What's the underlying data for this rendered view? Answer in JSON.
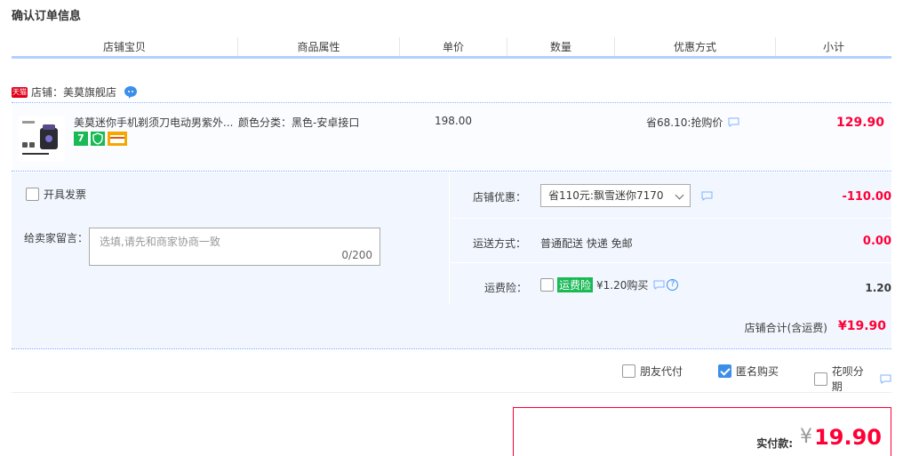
{
  "page": {
    "title": "确认订单信息"
  },
  "columns": [
    "店铺宝贝",
    "商品属性",
    "单价",
    "数量",
    "优惠方式",
    "小计"
  ],
  "shop": {
    "badge": "天猫",
    "label": "店铺：美莫旗舰店"
  },
  "item": {
    "title": "美莫迷你手机剃须刀电动男紫外...",
    "attribute": "颜色分类：黑色-安卓接口",
    "unit_price": "198.00",
    "discount": "省68.10:抢购价",
    "subtotal": "129.90",
    "badge_seven": "7"
  },
  "options": {
    "invoice_label": "开具发票",
    "message_label": "给卖家留言：",
    "message_placeholder": "选填,请先和商家协商一致",
    "message_count": "0/200",
    "shop_discount_label": "店铺优惠：",
    "shop_discount_selected": "省110元:飘雪迷你7170",
    "shop_discount_value": "-110.00",
    "shipping_label": "运送方式：",
    "shipping_text": "普通配送 快递 免邮",
    "shipping_value": "0.00",
    "insurance_label": "运费险：",
    "insurance_tag": "运费险",
    "insurance_text": "¥1.20购买",
    "insurance_value": "1.20"
  },
  "shop_total": {
    "label": "店铺合计(含运费)",
    "value": "¥19.90"
  },
  "pay_options": {
    "friend_pay": "朋友代付",
    "anonymous": "匿名购买",
    "anonymous_checked": true,
    "huabei": "花呗分期"
  },
  "final": {
    "label": "实付款:",
    "currency": "¥",
    "amount": "19.90"
  },
  "colors": {
    "accent_red": "#ff0036",
    "accent_blue": "#3c8fe8",
    "panel_bg": "#f2f7ff",
    "green": "#19b955"
  }
}
